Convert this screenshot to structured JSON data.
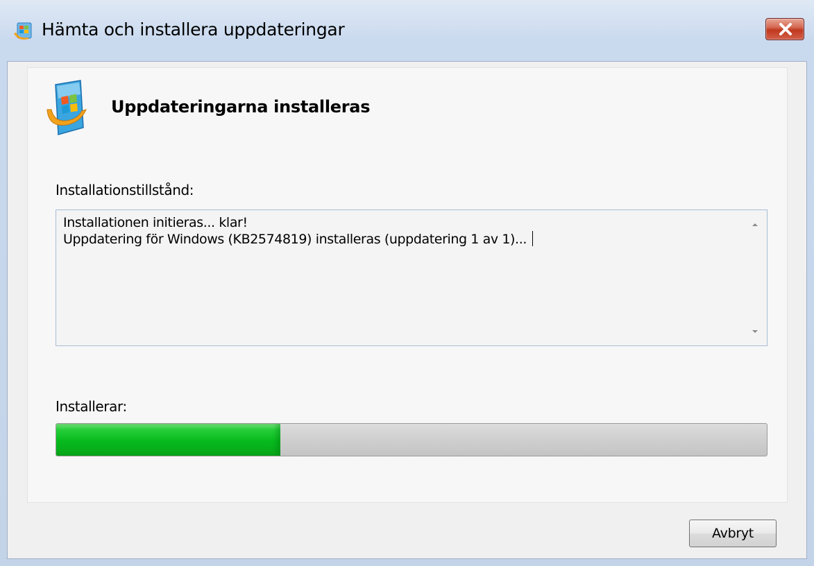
{
  "window": {
    "title": "Hämta och installera uppdateringar"
  },
  "main": {
    "heading": "Uppdateringarna installeras",
    "status_label": "Installationstillstånd:",
    "log_lines": [
      "Installationen initieras... klar!",
      "Uppdatering för Windows (KB2574819) installeras (uppdatering 1 av 1)..."
    ],
    "progress_label": "Installerar:",
    "progress_fraction": 0.315
  },
  "footer": {
    "cancel_label": "Avbryt"
  },
  "icons": {
    "title": "windows-update-icon",
    "heading": "windows-update-icon",
    "close": "close-icon",
    "scroll_up": "chevron-up-icon",
    "scroll_down": "chevron-down-icon"
  },
  "colors": {
    "progress_fill": "#06b91c",
    "close_button": "#c0391e"
  }
}
